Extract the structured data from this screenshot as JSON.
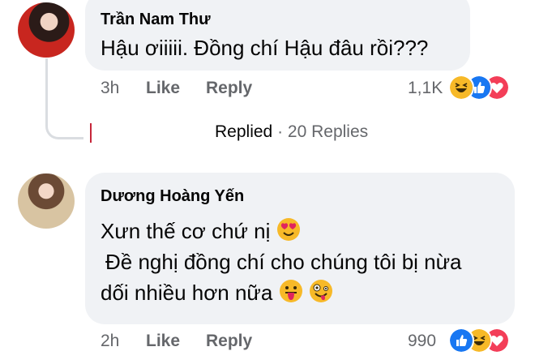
{
  "comments": [
    {
      "author": "Trần Nam Thư",
      "text": "Hậu ơiiiii. Đồng chí Hậu đâu rồi???",
      "time": "3h",
      "like": "Like",
      "reply": "Reply",
      "reaction_count": "1,1K",
      "reactions": [
        "haha-icon",
        "like-icon",
        "love-icon"
      ]
    },
    {
      "author": "Dương Hoàng Yến",
      "text_lines": [
        "Xưn thế cơ chứ nị",
        "Đề nghị đồng chí cho chúng tôi bị nừa",
        "dối nhiều hơn nữa"
      ],
      "time": "2h",
      "like": "Like",
      "reply": "Reply",
      "reaction_count": "990",
      "reactions": [
        "like-icon",
        "haha-icon",
        "love-icon"
      ]
    }
  ],
  "replies": {
    "label": "Replied",
    "separator": "·",
    "count": "20 Replies"
  },
  "colors": {
    "bubble": "#f0f2f5",
    "meta": "#65676b",
    "like_blue": "#1877f2",
    "love_red": "#f33e58",
    "haha_yellow": "#f7b928"
  }
}
